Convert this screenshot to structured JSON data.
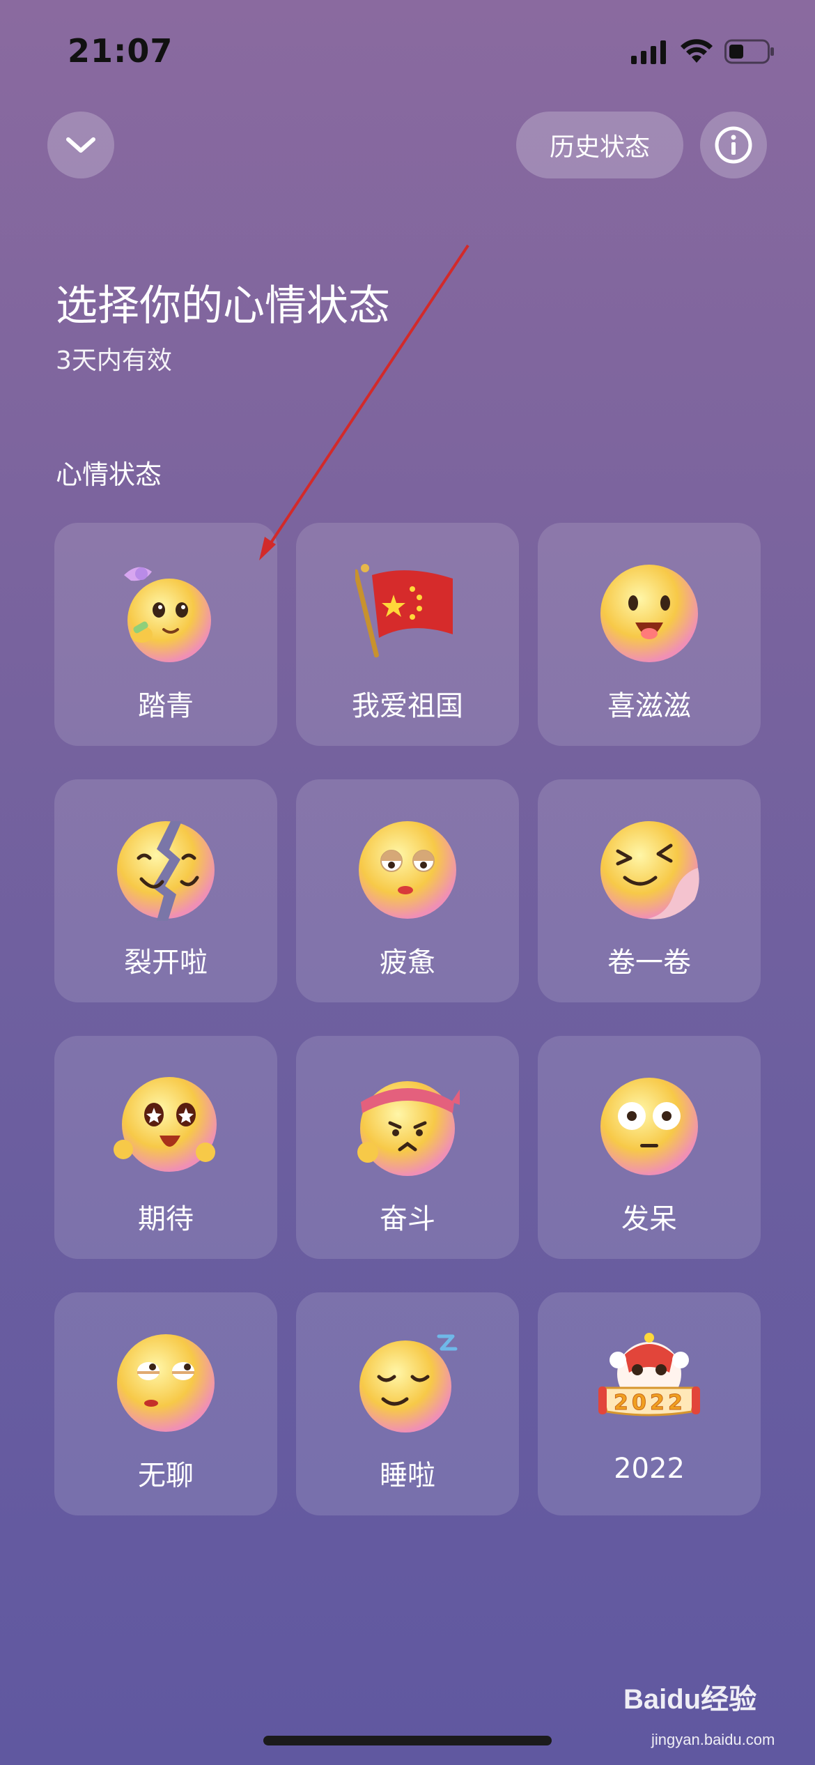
{
  "status_bar": {
    "time": "21:07"
  },
  "header": {
    "history_label": "历史状态"
  },
  "page": {
    "title": "选择你的心情状态",
    "subtitle": "3天内有效",
    "section_label": "心情状态"
  },
  "moods": [
    {
      "label": "踏青",
      "icon": "spring-outing-emoji-icon"
    },
    {
      "label": "我爱祖国",
      "icon": "china-flag-icon"
    },
    {
      "label": "喜滋滋",
      "icon": "happy-emoji-icon"
    },
    {
      "label": "裂开啦",
      "icon": "cracked-emoji-icon"
    },
    {
      "label": "疲惫",
      "icon": "tired-emoji-icon"
    },
    {
      "label": "卷一卷",
      "icon": "curled-emoji-icon"
    },
    {
      "label": "期待",
      "icon": "expecting-emoji-icon"
    },
    {
      "label": "奋斗",
      "icon": "striving-emoji-icon"
    },
    {
      "label": "发呆",
      "icon": "blank-stare-emoji-icon"
    },
    {
      "label": "无聊",
      "icon": "bored-emoji-icon"
    },
    {
      "label": "睡啦",
      "icon": "sleeping-emoji-icon"
    },
    {
      "label": "2022",
      "icon": "lion-dance-2022-icon"
    }
  ],
  "watermark": {
    "brand": "Baidu经验",
    "url": "jingyan.baidu.com"
  },
  "colors": {
    "background_top": "#8a6a9f",
    "background_bottom": "#6058a0",
    "emoji_yellow": "#f7c948",
    "arrow_red": "#d22a2a"
  }
}
